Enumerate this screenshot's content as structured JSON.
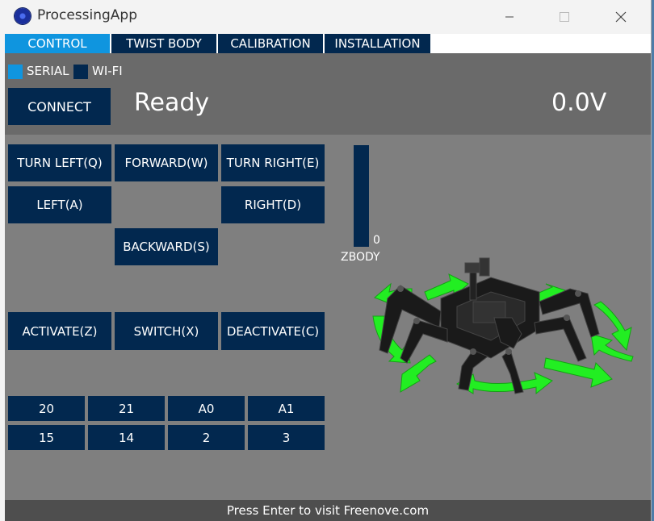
{
  "window": {
    "title": "ProcessingApp"
  },
  "tabs": [
    {
      "label": "CONTROL",
      "active": true
    },
    {
      "label": "TWIST BODY",
      "active": false
    },
    {
      "label": "CALIBRATION",
      "active": false
    },
    {
      "label": "INSTALLATION",
      "active": false
    }
  ],
  "connection": {
    "serial_label": "SERIAL",
    "wifi_label": "WI-FI",
    "serial_selected": true,
    "connect_label": "CONNECT",
    "status": "Ready",
    "voltage": "0.0V"
  },
  "movement": {
    "turn_left": "TURN LEFT(Q)",
    "forward": "FORWARD(W)",
    "turn_right": "TURN RIGHT(E)",
    "left": "LEFT(A)",
    "right": "RIGHT(D)",
    "backward": "BACKWARD(S)"
  },
  "actions": {
    "activate": "ACTIVATE(Z)",
    "switch": "SWITCH(X)",
    "deactivate": "DEACTIVATE(C)"
  },
  "zbody": {
    "label": "ZBODY",
    "value": "0"
  },
  "pins": [
    [
      "20",
      "21",
      "A0",
      "A1"
    ],
    [
      "15",
      "14",
      "2",
      "3"
    ]
  ],
  "footer": {
    "text": "Press Enter to visit Freenove.com"
  },
  "colors": {
    "button": "#02284f",
    "active_tab": "#0f95df",
    "panel": "#7f7f7f",
    "header": "#6a6a6a",
    "arrow": "#22ee22"
  },
  "icons": [
    "app-logo-icon",
    "minimize-icon",
    "maximize-icon",
    "close-icon",
    "hexapod-robot-icon"
  ]
}
